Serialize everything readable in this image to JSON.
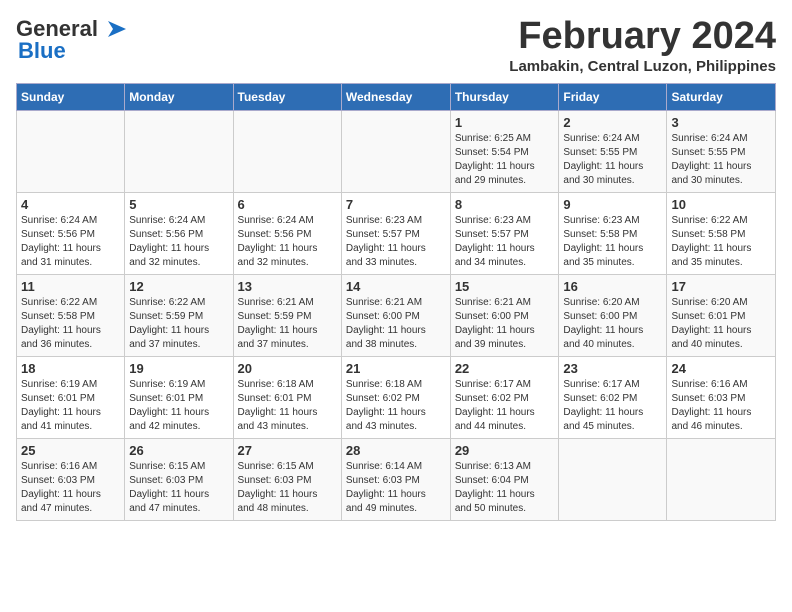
{
  "header": {
    "logo_line1": "General",
    "logo_line2": "Blue",
    "title": "February 2024",
    "subtitle": "Lambakin, Central Luzon, Philippines"
  },
  "weekdays": [
    "Sunday",
    "Monday",
    "Tuesday",
    "Wednesday",
    "Thursday",
    "Friday",
    "Saturday"
  ],
  "weeks": [
    [
      {
        "day": "",
        "info": ""
      },
      {
        "day": "",
        "info": ""
      },
      {
        "day": "",
        "info": ""
      },
      {
        "day": "",
        "info": ""
      },
      {
        "day": "1",
        "info": "Sunrise: 6:25 AM\nSunset: 5:54 PM\nDaylight: 11 hours\nand 29 minutes."
      },
      {
        "day": "2",
        "info": "Sunrise: 6:24 AM\nSunset: 5:55 PM\nDaylight: 11 hours\nand 30 minutes."
      },
      {
        "day": "3",
        "info": "Sunrise: 6:24 AM\nSunset: 5:55 PM\nDaylight: 11 hours\nand 30 minutes."
      }
    ],
    [
      {
        "day": "4",
        "info": "Sunrise: 6:24 AM\nSunset: 5:56 PM\nDaylight: 11 hours\nand 31 minutes."
      },
      {
        "day": "5",
        "info": "Sunrise: 6:24 AM\nSunset: 5:56 PM\nDaylight: 11 hours\nand 32 minutes."
      },
      {
        "day": "6",
        "info": "Sunrise: 6:24 AM\nSunset: 5:56 PM\nDaylight: 11 hours\nand 32 minutes."
      },
      {
        "day": "7",
        "info": "Sunrise: 6:23 AM\nSunset: 5:57 PM\nDaylight: 11 hours\nand 33 minutes."
      },
      {
        "day": "8",
        "info": "Sunrise: 6:23 AM\nSunset: 5:57 PM\nDaylight: 11 hours\nand 34 minutes."
      },
      {
        "day": "9",
        "info": "Sunrise: 6:23 AM\nSunset: 5:58 PM\nDaylight: 11 hours\nand 35 minutes."
      },
      {
        "day": "10",
        "info": "Sunrise: 6:22 AM\nSunset: 5:58 PM\nDaylight: 11 hours\nand 35 minutes."
      }
    ],
    [
      {
        "day": "11",
        "info": "Sunrise: 6:22 AM\nSunset: 5:58 PM\nDaylight: 11 hours\nand 36 minutes."
      },
      {
        "day": "12",
        "info": "Sunrise: 6:22 AM\nSunset: 5:59 PM\nDaylight: 11 hours\nand 37 minutes."
      },
      {
        "day": "13",
        "info": "Sunrise: 6:21 AM\nSunset: 5:59 PM\nDaylight: 11 hours\nand 37 minutes."
      },
      {
        "day": "14",
        "info": "Sunrise: 6:21 AM\nSunset: 6:00 PM\nDaylight: 11 hours\nand 38 minutes."
      },
      {
        "day": "15",
        "info": "Sunrise: 6:21 AM\nSunset: 6:00 PM\nDaylight: 11 hours\nand 39 minutes."
      },
      {
        "day": "16",
        "info": "Sunrise: 6:20 AM\nSunset: 6:00 PM\nDaylight: 11 hours\nand 40 minutes."
      },
      {
        "day": "17",
        "info": "Sunrise: 6:20 AM\nSunset: 6:01 PM\nDaylight: 11 hours\nand 40 minutes."
      }
    ],
    [
      {
        "day": "18",
        "info": "Sunrise: 6:19 AM\nSunset: 6:01 PM\nDaylight: 11 hours\nand 41 minutes."
      },
      {
        "day": "19",
        "info": "Sunrise: 6:19 AM\nSunset: 6:01 PM\nDaylight: 11 hours\nand 42 minutes."
      },
      {
        "day": "20",
        "info": "Sunrise: 6:18 AM\nSunset: 6:01 PM\nDaylight: 11 hours\nand 43 minutes."
      },
      {
        "day": "21",
        "info": "Sunrise: 6:18 AM\nSunset: 6:02 PM\nDaylight: 11 hours\nand 43 minutes."
      },
      {
        "day": "22",
        "info": "Sunrise: 6:17 AM\nSunset: 6:02 PM\nDaylight: 11 hours\nand 44 minutes."
      },
      {
        "day": "23",
        "info": "Sunrise: 6:17 AM\nSunset: 6:02 PM\nDaylight: 11 hours\nand 45 minutes."
      },
      {
        "day": "24",
        "info": "Sunrise: 6:16 AM\nSunset: 6:03 PM\nDaylight: 11 hours\nand 46 minutes."
      }
    ],
    [
      {
        "day": "25",
        "info": "Sunrise: 6:16 AM\nSunset: 6:03 PM\nDaylight: 11 hours\nand 47 minutes."
      },
      {
        "day": "26",
        "info": "Sunrise: 6:15 AM\nSunset: 6:03 PM\nDaylight: 11 hours\nand 47 minutes."
      },
      {
        "day": "27",
        "info": "Sunrise: 6:15 AM\nSunset: 6:03 PM\nDaylight: 11 hours\nand 48 minutes."
      },
      {
        "day": "28",
        "info": "Sunrise: 6:14 AM\nSunset: 6:03 PM\nDaylight: 11 hours\nand 49 minutes."
      },
      {
        "day": "29",
        "info": "Sunrise: 6:13 AM\nSunset: 6:04 PM\nDaylight: 11 hours\nand 50 minutes."
      },
      {
        "day": "",
        "info": ""
      },
      {
        "day": "",
        "info": ""
      }
    ]
  ]
}
